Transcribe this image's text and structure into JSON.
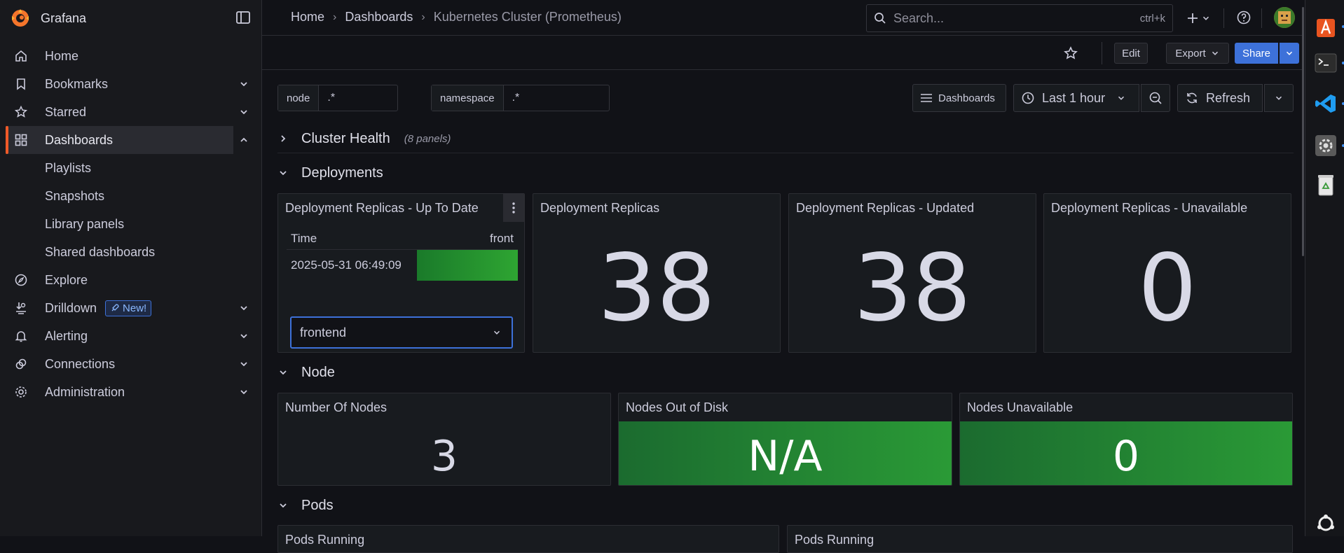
{
  "app": {
    "name": "Grafana"
  },
  "sidebar": {
    "items": [
      {
        "label": "Home",
        "icon": "home-icon"
      },
      {
        "label": "Bookmarks",
        "icon": "bookmark-icon"
      },
      {
        "label": "Starred",
        "icon": "star-icon"
      },
      {
        "label": "Dashboards",
        "icon": "dashboards-grid-icon"
      },
      {
        "label": "Playlists"
      },
      {
        "label": "Snapshots"
      },
      {
        "label": "Library panels"
      },
      {
        "label": "Shared dashboards"
      },
      {
        "label": "Explore",
        "icon": "compass-icon"
      },
      {
        "label": "Drilldown",
        "icon": "drilldown-icon",
        "badge": "New!"
      },
      {
        "label": "Alerting",
        "icon": "bell-icon"
      },
      {
        "label": "Connections",
        "icon": "connections-icon"
      },
      {
        "label": "Administration",
        "icon": "gear-icon"
      }
    ]
  },
  "breadcrumb": [
    "Home",
    "Dashboards",
    "Kubernetes Cluster (Prometheus)"
  ],
  "search": {
    "placeholder": "Search...",
    "shortcut": "ctrl+k"
  },
  "toolbar": {
    "edit": "Edit",
    "export": "Export",
    "share": "Share"
  },
  "variables": [
    {
      "label": "node",
      "value": ".*"
    },
    {
      "label": "namespace",
      "value": ".*"
    }
  ],
  "controls": {
    "dashboards": "Dashboards",
    "time_range": "Last 1 hour",
    "refresh": "Refresh"
  },
  "rows": {
    "cluster_health": {
      "title": "Cluster Health",
      "meta": "(8 panels)"
    },
    "deployments": {
      "title": "Deployments"
    },
    "node": {
      "title": "Node"
    },
    "pods": {
      "title": "Pods"
    }
  },
  "panels": {
    "replicas_up_to_date": {
      "title": "Deployment Replicas - Up To Date",
      "columns": [
        "Time",
        "front"
      ],
      "row_time": "2025-05-31 06:49:09",
      "dropdown_value": "frontend"
    },
    "replicas": {
      "title": "Deployment Replicas",
      "value": "38"
    },
    "replicas_updated": {
      "title": "Deployment Replicas - Updated",
      "value": "38"
    },
    "replicas_unavailable": {
      "title": "Deployment Replicas - Unavailable",
      "value": "0"
    },
    "nodes_count": {
      "title": "Number Of Nodes",
      "value": "3"
    },
    "nodes_out_of_disk": {
      "title": "Nodes Out of Disk",
      "value": "N/A"
    },
    "nodes_unavailable": {
      "title": "Nodes Unavailable",
      "value": "0"
    },
    "pods_running_1": {
      "title": "Pods Running"
    },
    "pods_running_2": {
      "title": "Pods Running"
    }
  },
  "colors": {
    "accent": "#3d71d9",
    "active": "#f05a28",
    "ok": "#2a9a36"
  }
}
